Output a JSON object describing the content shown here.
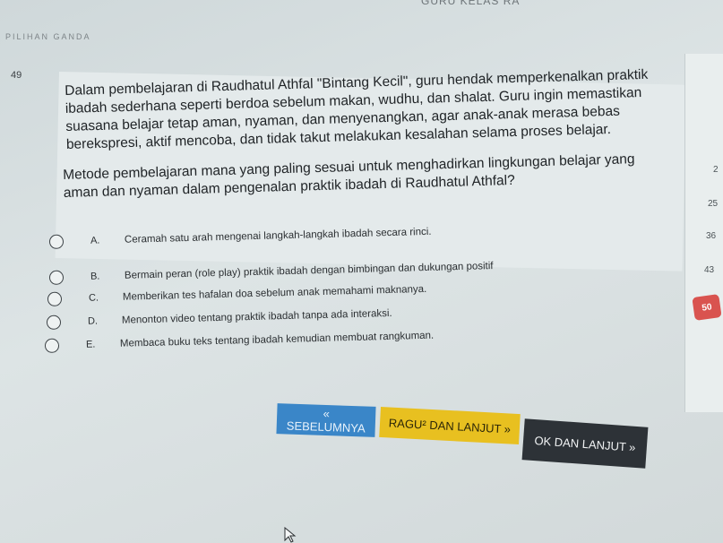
{
  "header": {
    "title": "GURU KELAS RA",
    "subtitle": "PILIHAN GANDA"
  },
  "question": {
    "number": "49",
    "paragraph_1": "Dalam pembelajaran di Raudhatul Athfal \"Bintang Kecil\", guru hendak memperkenalkan praktik ibadah sederhana seperti berdoa sebelum makan, wudhu, dan shalat. Guru ingin memastikan suasana belajar tetap aman, nyaman, dan menyenangkan, agar anak-anak merasa bebas berekspresi, aktif mencoba, dan tidak takut melakukan kesalahan selama proses belajar.",
    "paragraph_2": "Metode pembelajaran mana yang paling sesuai untuk menghadirkan lingkungan belajar yang aman dan nyaman dalam pengenalan praktik ibadah di Raudhatul Athfal?"
  },
  "options": [
    {
      "letter": "A.",
      "text": "Ceramah satu arah mengenai langkah-langkah ibadah secara rinci."
    },
    {
      "letter": "B.",
      "text": "Bermain peran (role play) praktik ibadah dengan bimbingan dan dukungan positif"
    },
    {
      "letter": "C.",
      "text": "Memberikan tes hafalan doa sebelum anak memahami maknanya."
    },
    {
      "letter": "D.",
      "text": "Menonton video tentang praktik ibadah tanpa ada interaksi."
    },
    {
      "letter": "E.",
      "text": "Membaca buku teks tentang ibadah kemudian membuat rangkuman."
    }
  ],
  "side_nav": {
    "numbers": [
      "2",
      "25",
      "36",
      "43"
    ],
    "active": "50"
  },
  "buttons": {
    "prev": "« SEBELUMNYA",
    "doubt": "RAGU² DAN LANJUT »",
    "ok": "OK DAN LANJUT »"
  },
  "colors": {
    "prev_button": "#3a86c8",
    "doubt_button": "#e8c020",
    "ok_button": "#2d3237",
    "active_number": "#d9534f"
  }
}
